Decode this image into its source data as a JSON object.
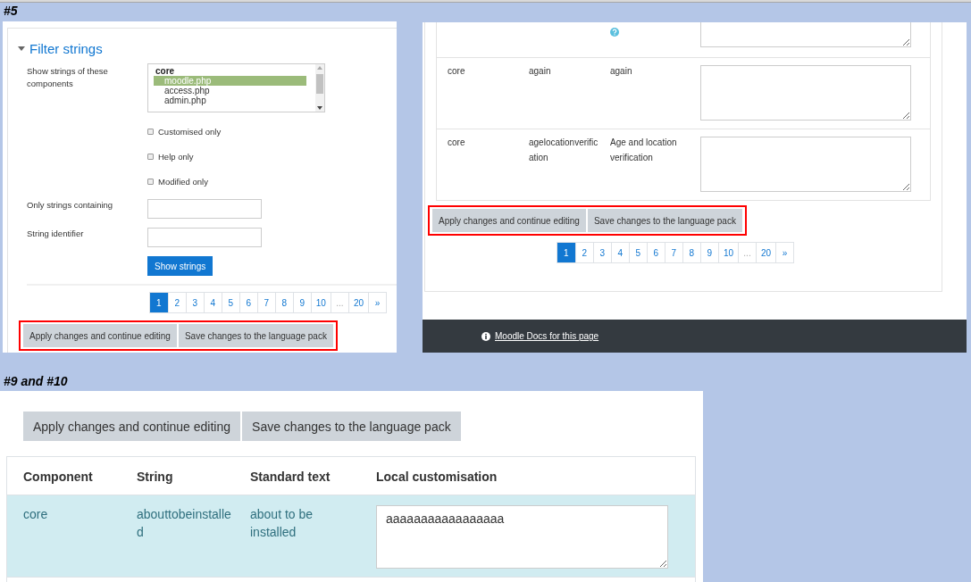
{
  "filter_panel": {
    "caption": "#5",
    "title": "Filter strings",
    "expanded": true,
    "components_label": "Show strings of these components",
    "listbox": {
      "group": "core",
      "options": [
        {
          "label": "moodle.php",
          "selected": true
        },
        {
          "label": "access.php",
          "selected": false
        },
        {
          "label": "admin.php",
          "selected": false
        }
      ]
    },
    "checkboxes": [
      {
        "label": "Customised only",
        "checked": false
      },
      {
        "label": "Help only",
        "checked": false
      },
      {
        "label": "Modified only",
        "checked": false
      }
    ],
    "fields": [
      {
        "label": "Only strings containing"
      },
      {
        "label": "String identifier"
      }
    ],
    "submit": "Show strings",
    "pagination": [
      {
        "label": "1",
        "selected": true,
        "disabled": false
      },
      {
        "label": "2",
        "selected": false,
        "disabled": false
      },
      {
        "label": "3",
        "selected": false,
        "disabled": false
      },
      {
        "label": "4",
        "selected": false,
        "disabled": false
      },
      {
        "label": "5",
        "selected": false,
        "disabled": false
      },
      {
        "label": "6",
        "selected": false,
        "disabled": false
      },
      {
        "label": "7",
        "selected": false,
        "disabled": false
      },
      {
        "label": "8",
        "selected": false,
        "disabled": false
      },
      {
        "label": "9",
        "selected": false,
        "disabled": false
      },
      {
        "label": "10",
        "selected": false,
        "disabled": false
      },
      {
        "label": "...",
        "selected": false,
        "disabled": true
      },
      {
        "label": "20",
        "selected": false,
        "disabled": false
      },
      {
        "label": "»",
        "selected": false,
        "disabled": false
      }
    ],
    "action_buttons": {
      "highlighted": true,
      "labels": [
        "Apply changes and continue editing",
        "Save changes to the language pack"
      ]
    }
  },
  "strings_panel": {
    "rows": [
      {
        "help": true
      },
      {
        "help": false,
        "component": "core",
        "string": "again",
        "standard_text": "again"
      },
      {
        "help": false,
        "component": "core",
        "string": "agelocationverification",
        "standard_text": "Age and location verification"
      }
    ],
    "action_buttons": {
      "highlighted": true,
      "labels": [
        "Apply changes and continue editing",
        "Save changes to the language pack"
      ]
    },
    "pagination": [
      {
        "label": "1",
        "selected": true,
        "disabled": false
      },
      {
        "label": "2",
        "selected": false,
        "disabled": false
      },
      {
        "label": "3",
        "selected": false,
        "disabled": false
      },
      {
        "label": "4",
        "selected": false,
        "disabled": false
      },
      {
        "label": "5",
        "selected": false,
        "disabled": false
      },
      {
        "label": "6",
        "selected": false,
        "disabled": false
      },
      {
        "label": "7",
        "selected": false,
        "disabled": false
      },
      {
        "label": "8",
        "selected": false,
        "disabled": false
      },
      {
        "label": "9",
        "selected": false,
        "disabled": false
      },
      {
        "label": "10",
        "selected": false,
        "disabled": false
      },
      {
        "label": "...",
        "selected": false,
        "disabled": true
      },
      {
        "label": "20",
        "selected": false,
        "disabled": false
      },
      {
        "label": "»",
        "selected": false,
        "disabled": false
      }
    ],
    "footer": {
      "link": "Moodle Docs for this page"
    }
  },
  "customisation_panel": {
    "caption": "#9 and #10",
    "action_buttons": {
      "highlighted": false,
      "labels": [
        "Apply changes and continue editing",
        "Save changes to the language pack"
      ]
    },
    "columns": [
      "Component",
      "String",
      "Standard text",
      "Local customisation"
    ],
    "rows": [
      {
        "selected": true,
        "component": "core",
        "string": "abouttobeinstalled",
        "standard_text": "about to be installed",
        "value": "aaaaaaaaaaaaaaaaa"
      },
      {
        "selected": false
      }
    ]
  }
}
